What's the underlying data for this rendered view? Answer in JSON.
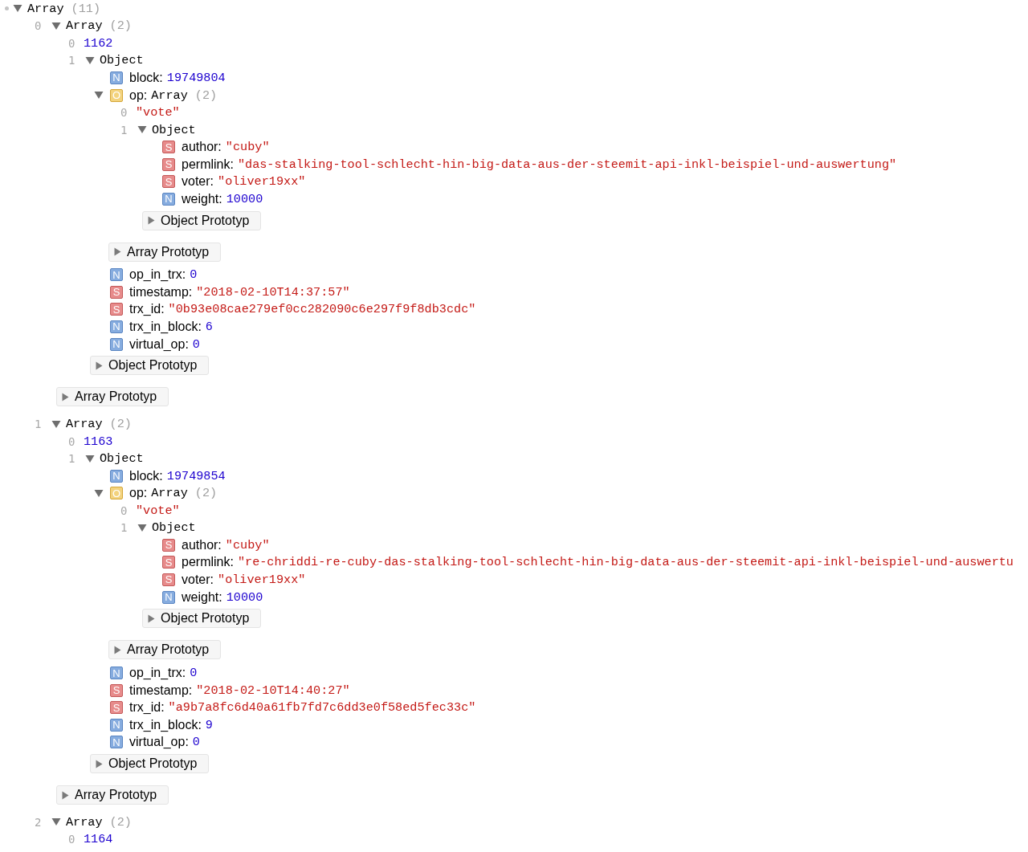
{
  "tree": {
    "label": "Array",
    "count": "(11)",
    "expanded": true,
    "children": [
      {
        "kind": "indexed",
        "index": "0",
        "label": "Array",
        "count": "(2)",
        "expanded": true,
        "children": [
          {
            "kind": "value",
            "index": "0",
            "value": "1162",
            "color": "#1c00cf"
          },
          {
            "kind": "indexed",
            "index": "1",
            "label": "Object",
            "expanded": true,
            "children": [
              {
                "kind": "property",
                "badge": "N",
                "key": "block:",
                "value": "19749804",
                "color": "#1c00cf"
              },
              {
                "kind": "property",
                "badge": "O",
                "key": "op:",
                "label": "Array",
                "count": "(2)",
                "expanded": true,
                "children": [
                  {
                    "kind": "value",
                    "index": "0",
                    "value": "\"vote\"",
                    "color": "#c41a16"
                  },
                  {
                    "kind": "indexed",
                    "index": "1",
                    "label": "Object",
                    "expanded": true,
                    "children": [
                      {
                        "kind": "property",
                        "badge": "S",
                        "key": "author:",
                        "value": "\"cuby\"",
                        "color": "#c41a16"
                      },
                      {
                        "kind": "property",
                        "badge": "S",
                        "key": "permlink:",
                        "value": "\"das-stalking-tool-schlecht-hin-big-data-aus-der-steemit-api-inkl-beispiel-und-auswertung\"",
                        "color": "#c41a16"
                      },
                      {
                        "kind": "property",
                        "badge": "S",
                        "key": "voter:",
                        "value": "\"oliver19xx\"",
                        "color": "#c41a16"
                      },
                      {
                        "kind": "property",
                        "badge": "N",
                        "key": "weight:",
                        "value": "10000",
                        "color": "#1c00cf"
                      },
                      {
                        "kind": "prototype",
                        "label": "Object Prototyp",
                        "expanded": false
                      }
                    ]
                  },
                  {
                    "kind": "prototype",
                    "label": "Array Prototyp",
                    "expanded": false
                  }
                ]
              },
              {
                "kind": "property",
                "badge": "N",
                "key": "op_in_trx:",
                "value": "0",
                "color": "#1c00cf"
              },
              {
                "kind": "property",
                "badge": "S",
                "key": "timestamp:",
                "value": "\"2018-02-10T14:37:57\"",
                "color": "#c41a16"
              },
              {
                "kind": "property",
                "badge": "S",
                "key": "trx_id:",
                "value": "\"0b93e08cae279ef0cc282090c6e297f9f8db3cdc\"",
                "color": "#c41a16"
              },
              {
                "kind": "property",
                "badge": "N",
                "key": "trx_in_block:",
                "value": "6",
                "color": "#1c00cf"
              },
              {
                "kind": "property",
                "badge": "N",
                "key": "virtual_op:",
                "value": "0",
                "color": "#1c00cf"
              },
              {
                "kind": "prototype",
                "label": "Object Prototyp",
                "expanded": false
              }
            ]
          },
          {
            "kind": "prototype",
            "label": "Array Prototyp",
            "expanded": false
          }
        ]
      },
      {
        "kind": "indexed",
        "index": "1",
        "label": "Array",
        "count": "(2)",
        "expanded": true,
        "children": [
          {
            "kind": "value",
            "index": "0",
            "value": "1163",
            "color": "#1c00cf"
          },
          {
            "kind": "indexed",
            "index": "1",
            "label": "Object",
            "expanded": true,
            "children": [
              {
                "kind": "property",
                "badge": "N",
                "key": "block:",
                "value": "19749854",
                "color": "#1c00cf"
              },
              {
                "kind": "property",
                "badge": "O",
                "key": "op:",
                "label": "Array",
                "count": "(2)",
                "expanded": true,
                "children": [
                  {
                    "kind": "value",
                    "index": "0",
                    "value": "\"vote\"",
                    "color": "#c41a16"
                  },
                  {
                    "kind": "indexed",
                    "index": "1",
                    "label": "Object",
                    "expanded": true,
                    "children": [
                      {
                        "kind": "property",
                        "badge": "S",
                        "key": "author:",
                        "value": "\"cuby\"",
                        "color": "#c41a16"
                      },
                      {
                        "kind": "property",
                        "badge": "S",
                        "key": "permlink:",
                        "value": "\"re-chriddi-re-cuby-das-stalking-tool-schlecht-hin-big-data-aus-der-steemit-api-inkl-beispiel-und-auswertu",
                        "color": "#c41a16"
                      },
                      {
                        "kind": "property",
                        "badge": "S",
                        "key": "voter:",
                        "value": "\"oliver19xx\"",
                        "color": "#c41a16"
                      },
                      {
                        "kind": "property",
                        "badge": "N",
                        "key": "weight:",
                        "value": "10000",
                        "color": "#1c00cf"
                      },
                      {
                        "kind": "prototype",
                        "label": "Object Prototyp",
                        "expanded": false
                      }
                    ]
                  },
                  {
                    "kind": "prototype",
                    "label": "Array Prototyp",
                    "expanded": false
                  }
                ]
              },
              {
                "kind": "property",
                "badge": "N",
                "key": "op_in_trx:",
                "value": "0",
                "color": "#1c00cf"
              },
              {
                "kind": "property",
                "badge": "S",
                "key": "timestamp:",
                "value": "\"2018-02-10T14:40:27\"",
                "color": "#c41a16"
              },
              {
                "kind": "property",
                "badge": "S",
                "key": "trx_id:",
                "value": "\"a9b7a8fc6d40a61fb7fd7c6dd3e0f58ed5fec33c\"",
                "color": "#c41a16"
              },
              {
                "kind": "property",
                "badge": "N",
                "key": "trx_in_block:",
                "value": "9",
                "color": "#1c00cf"
              },
              {
                "kind": "property",
                "badge": "N",
                "key": "virtual_op:",
                "value": "0",
                "color": "#1c00cf"
              },
              {
                "kind": "prototype",
                "label": "Object Prototyp",
                "expanded": false
              }
            ]
          },
          {
            "kind": "prototype",
            "label": "Array Prototyp",
            "expanded": false
          }
        ]
      },
      {
        "kind": "indexed",
        "index": "2",
        "label": "Array",
        "count": "(2)",
        "expanded": true,
        "children": [
          {
            "kind": "value",
            "index": "0",
            "value": "1164",
            "color": "#1c00cf"
          }
        ]
      }
    ]
  }
}
